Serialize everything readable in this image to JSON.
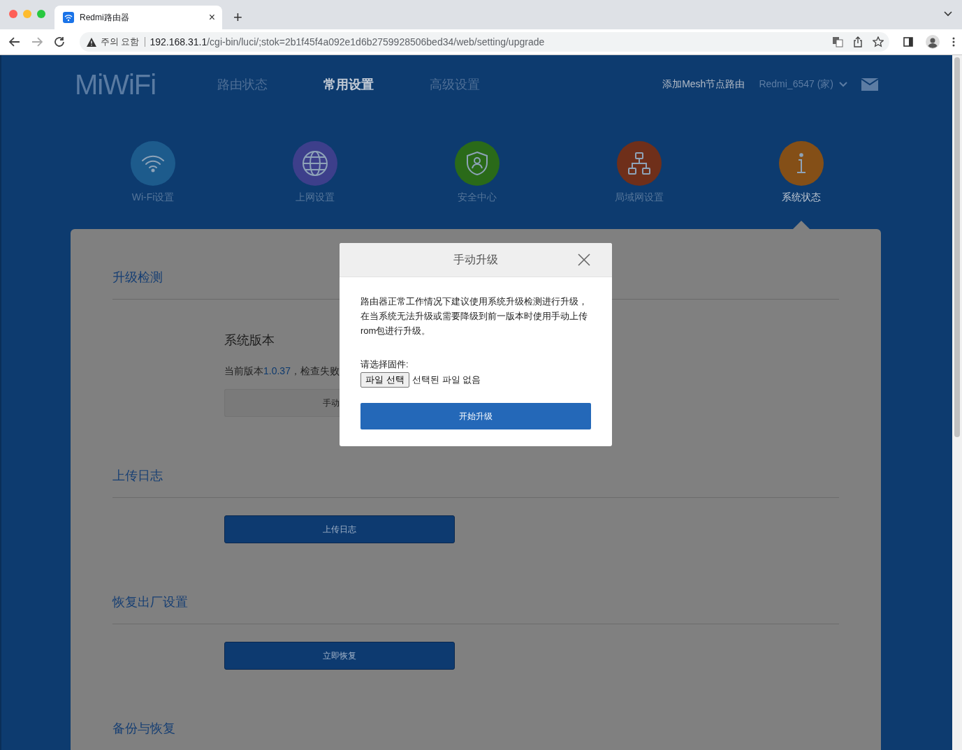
{
  "browser": {
    "tab": {
      "title": "Redmi路由器",
      "close": "×"
    },
    "new_tab": "+",
    "security_label": "주의 요함",
    "url_host": "192.168.31.1",
    "url_path": "/cgi-bin/luci/;stok=2b1f45f4a092e1d6b2759928506bed34/web/setting/upgrade"
  },
  "header": {
    "logo": "MiWiFi",
    "nav": [
      {
        "label": "路由状态",
        "selected": false
      },
      {
        "label": "常用设置",
        "selected": true
      },
      {
        "label": "高级设置",
        "selected": false
      }
    ],
    "mesh_link": "添加Mesh节点路由",
    "router_name": "Redmi_6547 (家)"
  },
  "categories": [
    {
      "label": "Wi-Fi设置",
      "kind": "wifi",
      "color": "#1d5b8c",
      "selected": false
    },
    {
      "label": "上网设置",
      "kind": "globe",
      "color": "#3d3f8b",
      "selected": false
    },
    {
      "label": "安全中心",
      "kind": "shield",
      "color": "#2a6a19",
      "selected": false
    },
    {
      "label": "局域网设置",
      "kind": "network",
      "color": "#6f2f1a",
      "selected": false
    },
    {
      "label": "系统状态",
      "kind": "info",
      "color": "#844f17",
      "selected": true
    }
  ],
  "sections": [
    {
      "title": "升级检测",
      "kind": "version",
      "subtitle": "系统版本",
      "status_prefix": "当前版本",
      "version": "1.0.37",
      "status_suffix": "，检查失败",
      "button": "手动"
    },
    {
      "title": "上传日志",
      "kind": "action",
      "button": "上传日志"
    },
    {
      "title": "恢复出厂设置",
      "kind": "action",
      "button": "立即恢复"
    },
    {
      "title": "备份与恢复",
      "kind": "title"
    }
  ],
  "dialog": {
    "title": "手动升级",
    "message": "路由器正常工作情况下建议使用系统升级检测进行升级，在当系统无法升级或需要降级到前一版本时使用手动上传rom包进行升级。",
    "file_label": "请选择固件:",
    "file_button": "파일 선택",
    "file_status": "선택된 파일 없음",
    "submit": "开始升级"
  }
}
